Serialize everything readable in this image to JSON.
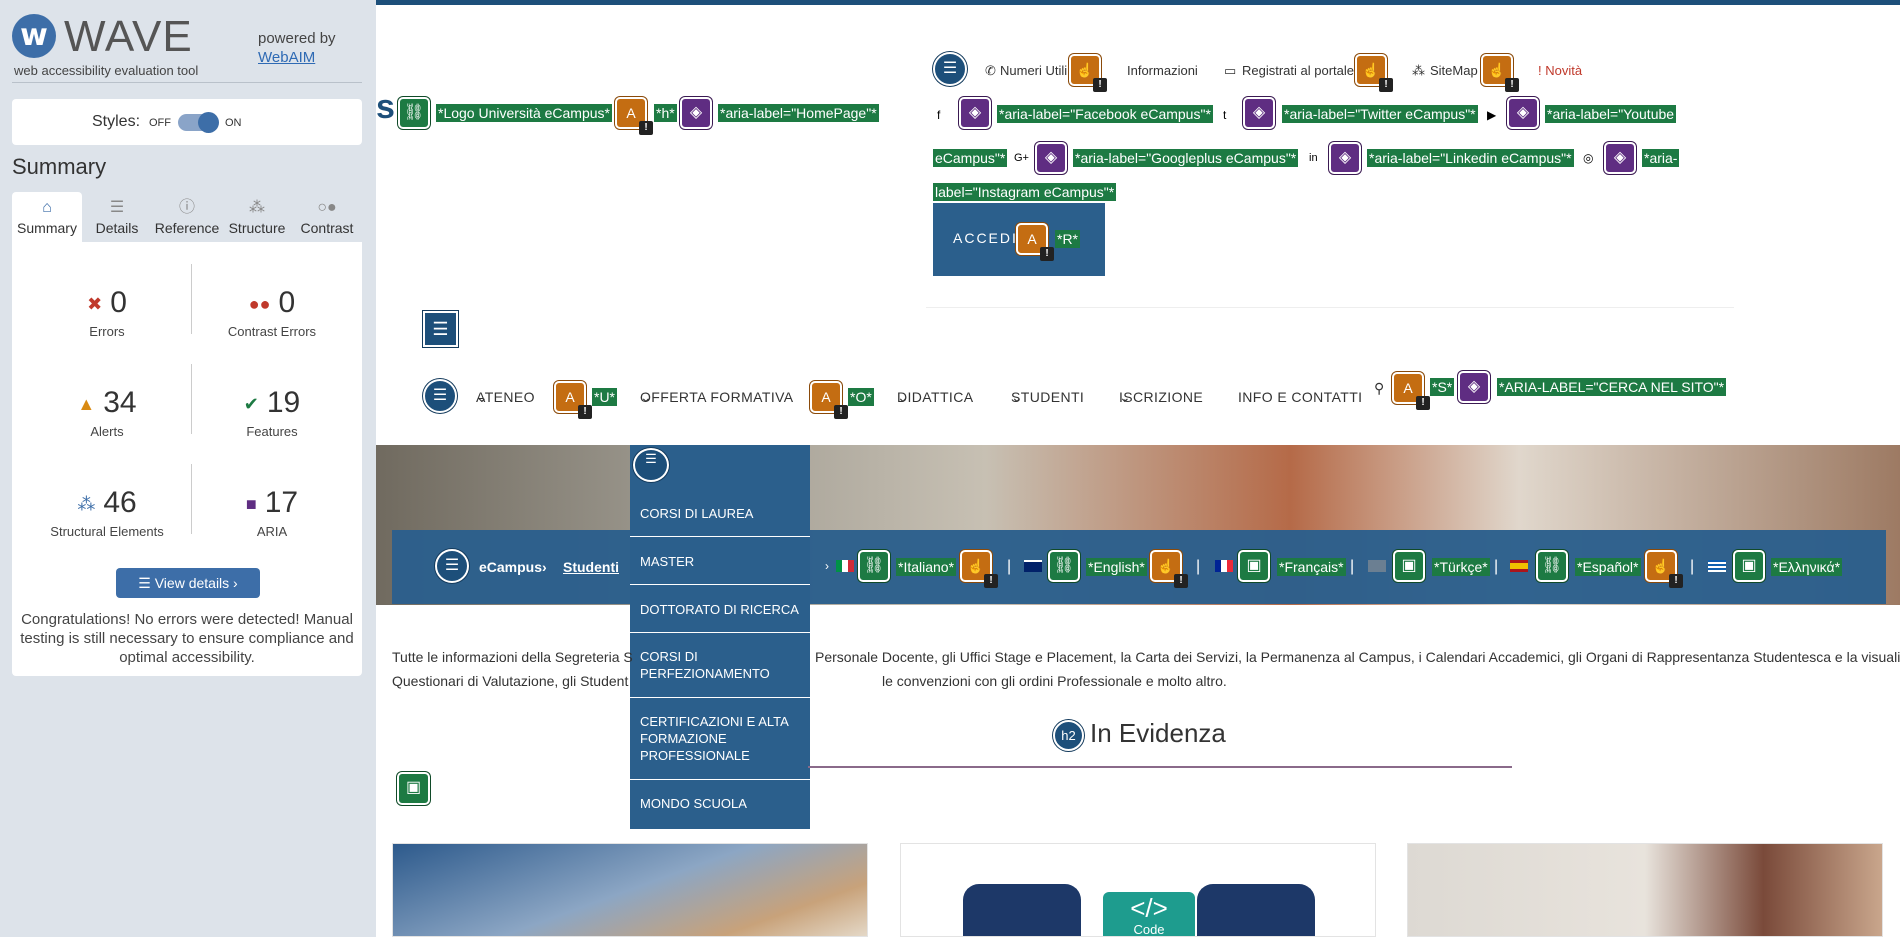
{
  "wave": {
    "title": "WAVE",
    "subtitle": "web accessibility evaluation tool",
    "powered_by": "powered by",
    "webaim": "WebAIM",
    "styles_label": "Styles:",
    "off": "OFF",
    "on": "ON",
    "summary_heading": "Summary",
    "tabs": [
      "Summary",
      "Details",
      "Reference",
      "Structure",
      "Contrast"
    ],
    "stats": {
      "errors": {
        "value": "0",
        "label": "Errors"
      },
      "contrast_errors": {
        "value": "0",
        "label": "Contrast Errors"
      },
      "alerts": {
        "value": "34",
        "label": "Alerts"
      },
      "features": {
        "value": "19",
        "label": "Features"
      },
      "structural": {
        "value": "46",
        "label": "Structural Elements"
      },
      "aria": {
        "value": "17",
        "label": "ARIA"
      }
    },
    "view_details": "View details ›",
    "message": "Congratulations! No errors were detected! Manual testing is still necessary to ensure compliance and optimal accessibility."
  },
  "page": {
    "logo_tags": {
      "logo": "*Logo Università eCampus*",
      "h": "*h*",
      "homepage": "*aria-label=\"HomePage\"*"
    },
    "toplinks": [
      "Numeri Utili",
      "Informazioni",
      "Registrati al portale",
      "SiteMap",
      "! Novità"
    ],
    "social_tags": [
      "*aria-label=\"Facebook eCampus\"*",
      "*aria-label=\"Twitter eCampus\"*",
      "*aria-label=\"Youtube",
      "eCampus\"*",
      "*aria-label=\"Googleplus eCampus\"*",
      "*aria-label=\"Linkedin eCampus\"*",
      "*aria-",
      "label=\"Instagram eCampus\"*"
    ],
    "accedi": "ACCEDI",
    "accedi_tag": "*R*",
    "nav": [
      "ATENEO",
      "OFFERTA FORMATIVA",
      "DIDATTICA",
      "STUDENTI",
      "ISCRIZIONE",
      "INFO E CONTATTI"
    ],
    "nav_tags": {
      "u": "*U*",
      "o": "*O*",
      "s": "*S*",
      "search": "*ARIA-LABEL=\"CERCA NEL SITO\"*"
    },
    "dropdown": [
      "CORSI DI LAUREA",
      "MASTER",
      "DOTTORATO DI RICERCA",
      "CORSI DI PERFEZIONAMENTO",
      "CERTIFICAZIONI E ALTA FORMAZIONE PROFESSIONALE",
      "MONDO SCUOLA"
    ],
    "breadcrumb": {
      "home": "eCampus",
      "current": "Studenti"
    },
    "languages": [
      "*Italiano*",
      "*English*",
      "*Français*",
      "*Türkçe*",
      "*Español*",
      "*Ελληνικά*"
    ],
    "intro_a": "Tutte le informazioni della Segreteria S",
    "intro_b": "Personale Docente, gli Uffici Stage e Placement, la Carta dei Servizi, la Permanenza al Campus, i Calendari Accademici, gli Organi di Rappresentanza Studentesca e la visualizzazione dei",
    "intro_c": "Questionari di Valutazione, gli Student",
    "intro_d": "le convenzioni con gli ordini Professionale e molto altro.",
    "heading": "In Evidenza",
    "h2_icon": "h2",
    "code_label": "Code"
  },
  "colors": {
    "wave_blue": "#3d6ea8",
    "tag_green": "#1d7a43",
    "alert_orange": "#c46d12",
    "aria_purple": "#5f2d82",
    "site_blue": "#2b5f8c"
  }
}
